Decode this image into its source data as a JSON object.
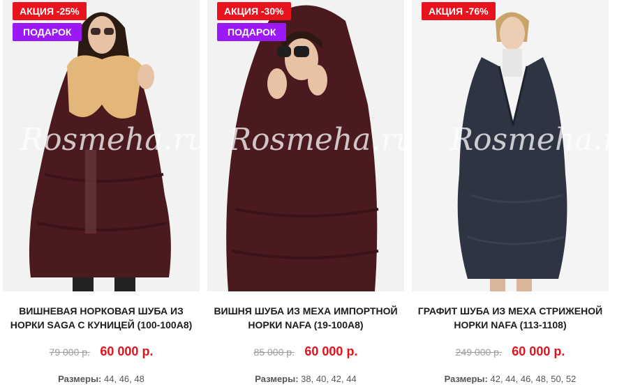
{
  "products": [
    {
      "sale_badge": "АКЦИЯ -25%",
      "gift_badge": "ПОДАРОК",
      "watermark": "Rosmeha.ru",
      "title": "ВИШНЕВАЯ НОРКОВАЯ ШУБА ИЗ НОРКИ SAGA С КУНИЦЕЙ (100-100А8)",
      "old_price": "79 000 р.",
      "new_price": "60 000 р.",
      "sizes_label": "Размеры:",
      "sizes": "44, 46, 48"
    },
    {
      "sale_badge": "АКЦИЯ -30%",
      "gift_badge": "ПОДАРОК",
      "watermark": "Rosmeha.ru",
      "title": "ВИШНЯ ШУБА ИЗ МЕХА ИМПОРТНОЙ НОРКИ NAFA (19-100А8)",
      "old_price": "85 000 р.",
      "new_price": "60 000 р.",
      "sizes_label": "Размеры:",
      "sizes": "38, 40, 42, 44"
    },
    {
      "sale_badge": "АКЦИЯ -76%",
      "watermark": "Rosmeha.r",
      "title": "ГРАФИТ ШУБА ИЗ МЕХА СТРИЖЕНОЙ НОРКИ NAFA (113-1108)",
      "old_price": "249 000 р.",
      "new_price": "60 000 р.",
      "sizes_label": "Размеры:",
      "sizes": "42, 44, 46, 48, 50, 52"
    }
  ],
  "colors": {
    "sale_badge": "#e8131d",
    "gift_badge": "#9b19f5",
    "new_price": "#e3121b",
    "old_price": "#9c9c9c",
    "coat_cherry": "#4a1a1f",
    "coat_graphite": "#2f3442",
    "fur_collar": "#e3b77a"
  }
}
